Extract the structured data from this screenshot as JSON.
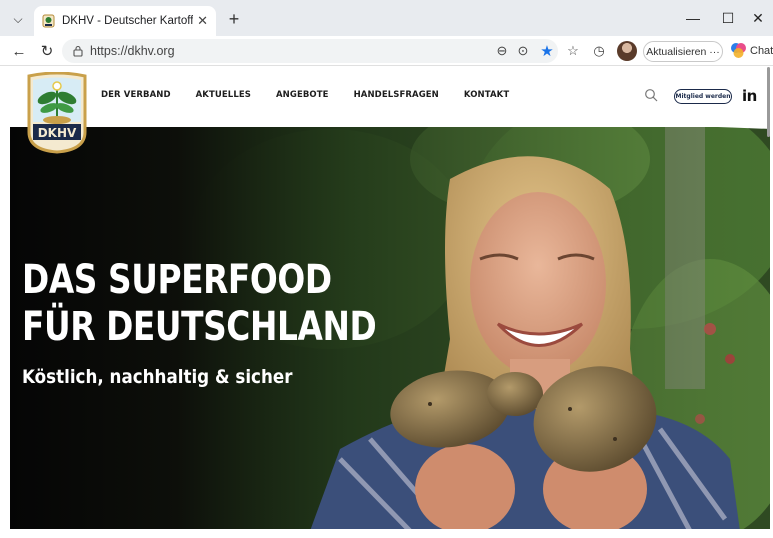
{
  "browser": {
    "tab_title": "DKHV - Deutscher Kartoffelhandel",
    "tab_close": "✕",
    "new_tab": "+",
    "url": "https://dkhv.org",
    "update_label": "Aktualisieren ···",
    "chat_label": "Chat",
    "window": {
      "minimize": "—",
      "maximize": "☐",
      "close": "✕"
    }
  },
  "site": {
    "logo_text": "DKHV",
    "nav": [
      "DER VERBAND",
      "AKTUELLES",
      "ANGEBOTE",
      "HANDELSFRAGEN",
      "KONTAKT"
    ],
    "member_button": "Mitglied werden",
    "social": "in"
  },
  "hero": {
    "headline_line1": "DAS SUPERFOOD",
    "headline_line2": "FÜR DEUTSCHLAND",
    "subline": "Köstlich, nachhaltig & sicher"
  },
  "colors": {
    "brand_navy": "#1b2a4a",
    "logo_green": "#2e7d32",
    "logo_gold": "#c9a04a",
    "hero_text": "#ffffff"
  }
}
